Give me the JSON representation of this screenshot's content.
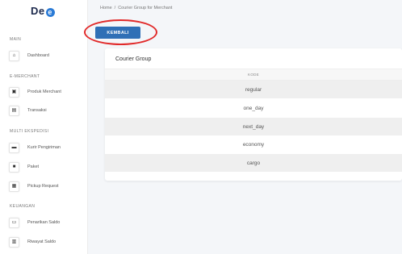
{
  "brand": {
    "logo_text": "De",
    "logo_badge": "e"
  },
  "sidebar": {
    "sections": [
      {
        "title": "MAIN"
      },
      {
        "title": "E-MERCHANT"
      },
      {
        "title": "MULTI EKSPEDISI"
      },
      {
        "title": "KEUANGAN"
      }
    ],
    "items": [
      {
        "label": "Dashboard",
        "icon": "home-icon",
        "glyph": "⌂"
      },
      {
        "label": "Produk Merchant",
        "icon": "box-icon",
        "glyph": "▣"
      },
      {
        "label": "Transaksi",
        "icon": "receipt-icon",
        "glyph": "▤"
      },
      {
        "label": "Kurir Pengiriman",
        "icon": "truck-icon",
        "glyph": "▬"
      },
      {
        "label": "Paket",
        "icon": "package-icon",
        "glyph": "■"
      },
      {
        "label": "Pickup Request",
        "icon": "clipboard-icon",
        "glyph": "▦"
      },
      {
        "label": "Penarikan Saldo",
        "icon": "wallet-icon",
        "glyph": "▭"
      },
      {
        "label": "Riwayat Saldo",
        "icon": "history-icon",
        "glyph": "▥"
      }
    ]
  },
  "breadcrumb": {
    "home": "Home",
    "separator": "/",
    "current": "Courier Group for Merchant"
  },
  "back_button": {
    "label": "KEMBALI"
  },
  "card": {
    "title": "Courier Group",
    "column_header": "KODE",
    "rows": [
      "regular",
      "one_day",
      "next_day",
      "economy",
      "cargo"
    ]
  },
  "colors": {
    "accent": "#2f6fb6",
    "highlight_ring": "#e12a2a"
  }
}
